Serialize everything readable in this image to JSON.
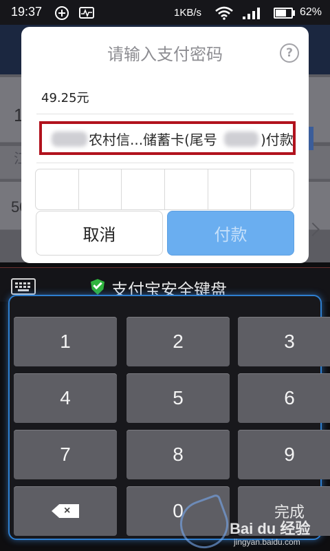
{
  "status_bar": {
    "time": "19:37",
    "net_speed": "1KB/s",
    "battery_percent": "62%",
    "battery_level": 0.62
  },
  "background_app": {
    "row1_text": "1",
    "row2_text": "江",
    "row3_text": "50"
  },
  "dialog": {
    "title": "请输入支付密码",
    "help_symbol": "?",
    "amount": "49.25元",
    "card_text_main": "农村信...储蓄卡(尾号",
    "card_text_end": ")付款",
    "password_cell_count": 6,
    "cancel_label": "取消",
    "pay_label": "付款"
  },
  "keyboard": {
    "title": "支付宝安全键盘",
    "keys": {
      "k1": "1",
      "k2": "2",
      "k3": "3",
      "k4": "4",
      "k5": "5",
      "k6": "6",
      "k7": "7",
      "k8": "8",
      "k9": "9",
      "k0": "0",
      "done": "完成"
    }
  },
  "watermark": {
    "logo": "Bai du 经验",
    "url": "jingyan.baidu.com"
  },
  "colors": {
    "pay_button": "#6aaef0",
    "highlight_border": "#b1121d",
    "shield": "#2fb33d",
    "keyboard_glow": "#2e7fd0"
  }
}
